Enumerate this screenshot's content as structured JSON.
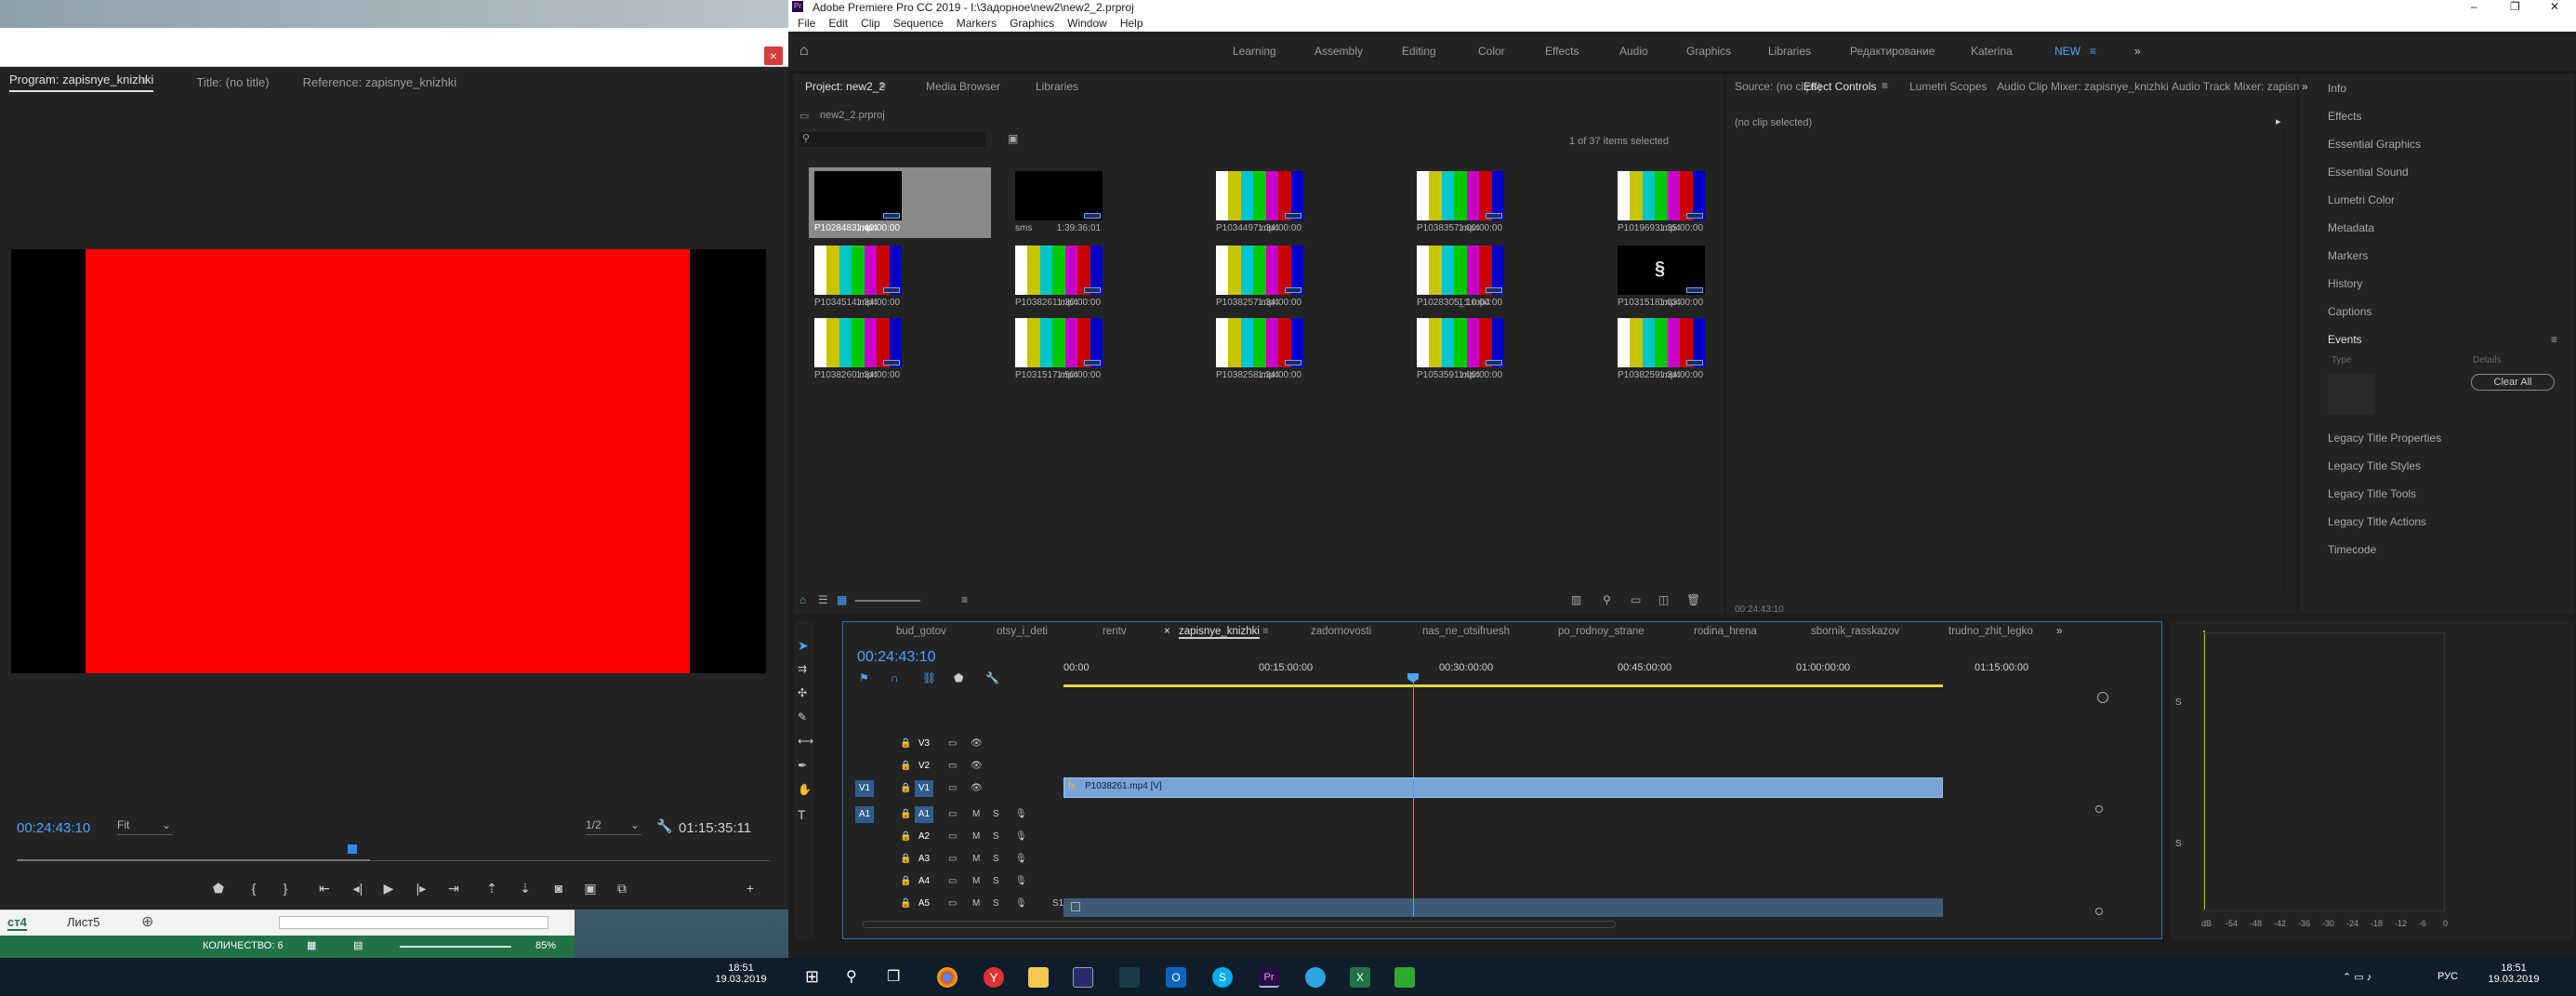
{
  "program_monitor": {
    "tab_program": "Program: zapisnye_knizhki",
    "tab_title": "Title: (no title)",
    "tab_reference": "Reference: zapisnye_knizhki",
    "timecode_current": "00:24:43:10",
    "fit": "Fit",
    "resolution": "1/2",
    "timecode_duration": "01:15:35:11",
    "close": "×",
    "frame_color": "#ff0000"
  },
  "excel": {
    "sheet_active": "ст4",
    "sheet_other": "Лист5",
    "status_count": "КОЛИЧЕСТВО: 6",
    "zoom": "85%"
  },
  "premiere": {
    "window_title": "Adobe Premiere Pro CC 2019 - I:\\Задорное\\new2\\new2_2.prproj",
    "menus": [
      "File",
      "Edit",
      "Clip",
      "Sequence",
      "Markers",
      "Graphics",
      "Window",
      "Help"
    ],
    "workspaces": [
      "Learning",
      "Assembly",
      "Editing",
      "Color",
      "Effects",
      "Audio",
      "Graphics",
      "Libraries",
      "Редактирование",
      "Katerina",
      "NEW"
    ],
    "more": "»"
  },
  "project_panel": {
    "tab_project": "Project: new2_2",
    "tab_media": "Media Browser",
    "tab_libraries": "Libraries",
    "project_file": "new2_2.prproj",
    "items_selected": "1 of 37 items selected",
    "clips": [
      {
        "name": "P1028483.mp4",
        "dur": "1:40:00:00",
        "kind": "black"
      },
      {
        "name": "sms",
        "dur": "1:39:36:01",
        "kind": "black"
      },
      {
        "name": "P1034497.mp4",
        "dur": "1:34:00:00",
        "kind": "bars"
      },
      {
        "name": "P1038357.mp4",
        "dur": "1:00:00:00",
        "kind": "bars"
      },
      {
        "name": "P1019693.mp4",
        "dur": "1:35:00:00",
        "kind": "bars"
      },
      {
        "name": "P1034514.mp4",
        "dur": "1:34:00:00",
        "kind": "bars"
      },
      {
        "name": "P1038261.mp4",
        "dur": "1:30:00:00",
        "kind": "bars"
      },
      {
        "name": "P1038257.mp4",
        "dur": "1:34:00:00",
        "kind": "bars"
      },
      {
        "name": "P1028305_1.mp4",
        "dur": "1:10:00:00",
        "kind": "bars"
      },
      {
        "name": "P1031518.mp4",
        "dur": "1:03:00:00",
        "kind": "s"
      },
      {
        "name": "P1038260.mp4",
        "dur": "1:34:00:00",
        "kind": "bars"
      },
      {
        "name": "P1031517.mp4",
        "dur": "1:50:00:00",
        "kind": "bars"
      },
      {
        "name": "P1038258.mp4",
        "dur": "1:34:00:00",
        "kind": "bars"
      },
      {
        "name": "P1053591.mp4",
        "dur": "1:00:00:00",
        "kind": "bars"
      },
      {
        "name": "P1038259.mp4",
        "dur": "1:34:00:00",
        "kind": "bars"
      }
    ]
  },
  "effect_controls": {
    "tab_source": "Source: (no clips)",
    "tab_effect_controls": "Effect Controls",
    "tab_lumetri": "Lumetri Scopes",
    "tab_audio_clip_mixer": "Audio Clip Mixer: zapisnye_knizhki",
    "tab_audio_track_mixer": "Audio Track Mixer: zapisny",
    "no_clip": "(no clip selected)",
    "timecode": "00:24:43:10"
  },
  "right_panels": {
    "items": [
      "Info",
      "Effects",
      "Essential Graphics",
      "Essential Sound",
      "Lumetri Color",
      "Metadata",
      "Markers",
      "History",
      "Captions"
    ],
    "events_title": "Events",
    "events_type": "Type",
    "events_details": "Details",
    "clear_all": "Clear All",
    "items2": [
      "Legacy Title Properties",
      "Legacy Title Styles",
      "Legacy Title Tools",
      "Legacy Title Actions",
      "Timecode"
    ]
  },
  "timeline": {
    "sequences": [
      "bud_gotov",
      "otsy_i_deti",
      "rentv",
      "zapisnye_knizhki",
      "zadornovosti",
      "nas_ne_otsifruesh",
      "po_rodnoy_strane",
      "rodina_hrena",
      "sbornik_rasskazov",
      "trudno_zhit_legko"
    ],
    "active_sequence": "zapisnye_knizhki",
    "timecode": "00:24:43:10",
    "ruler": [
      "00:00",
      "00:15:00:00",
      "00:30:00:00",
      "00:45:00:00",
      "01:00:00:00",
      "01:15:00:00"
    ],
    "video_tracks": [
      "V3",
      "V2",
      "V1"
    ],
    "audio_tracks": [
      "A1",
      "A2",
      "A3",
      "A4",
      "A5"
    ],
    "clip_label": "P1038261.mp4 [V]",
    "source_v1": "V1",
    "source_a1": "A1",
    "track_m": "M",
    "track_s": "S",
    "a5_level": "S1"
  },
  "audio_meter": {
    "scale": [
      "dB",
      "-54",
      "-48",
      "-42",
      "-36",
      "-30",
      "-24",
      "-18",
      "-12",
      "-6",
      "0"
    ],
    "s_label": "S"
  },
  "taskbar": {
    "clock_left_time": "18:51",
    "clock_left_date": "19.03.2019",
    "lang": "РУС",
    "clock_time": "18:51",
    "clock_date": "19.03.2019"
  }
}
